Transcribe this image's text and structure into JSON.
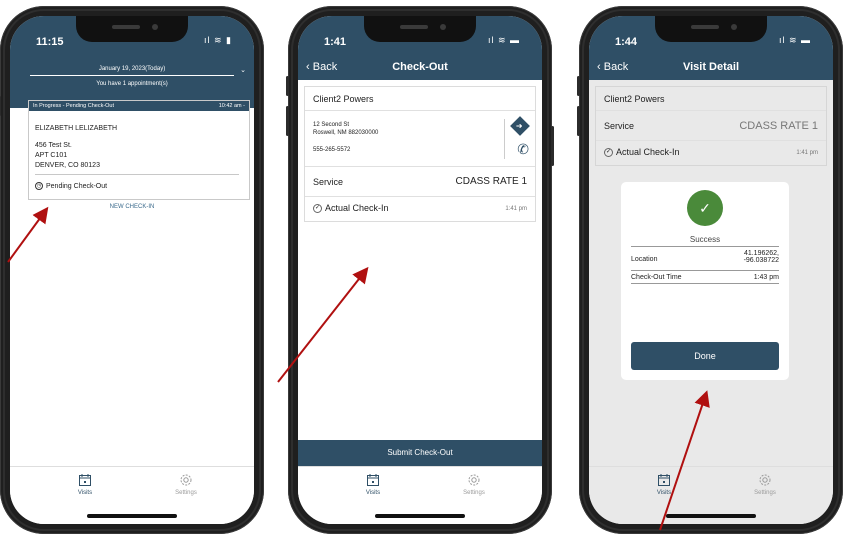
{
  "phone1": {
    "status_time": "11:15",
    "date_label": "January 19, 2023(Today)",
    "appointment_count": "You have 1 appointment(s)",
    "card": {
      "status": "In Progress - Pending Check-Out",
      "time": "10:42 am -",
      "client_name": "ELIZABETH LELIZABETH",
      "address_line1": "456 Test St.",
      "address_line2": "APT C101",
      "address_line3": "DENVER, CO 80123",
      "checkout_status": "Pending Check-Out"
    },
    "new_checkin": "NEW CHECK-IN",
    "tabs": {
      "visits": "Visits",
      "settings": "Settings"
    }
  },
  "phone2": {
    "status_time": "1:41",
    "nav": {
      "back": "Back",
      "title": "Check-Out"
    },
    "client_name": "Client2 Powers",
    "address_line1": "12 Second St",
    "address_line2": "Roswell, NM 882030000",
    "phone": "555-265-5572",
    "service_label": "Service",
    "service_value": "CDASS RATE 1",
    "checkin_label": "Actual Check-In",
    "checkin_time": "1:41 pm",
    "submit_label": "Submit Check-Out",
    "tabs": {
      "visits": "Visits",
      "settings": "Settings"
    }
  },
  "phone3": {
    "status_time": "1:44",
    "nav": {
      "back": "Back",
      "title": "Visit Detail"
    },
    "client_name": "Client2 Powers",
    "service_label": "Service",
    "service_value": "CDASS RATE 1",
    "checkin_label": "Actual Check-In",
    "checkin_time": "1:41 pm",
    "modal": {
      "title": "Success",
      "location_label": "Location",
      "location_value_line1": "41.196262,",
      "location_value_line2": "-96.038722",
      "checkout_label": "Check-Out Time",
      "checkout_value": "1:43 pm",
      "done_label": "Done"
    },
    "tabs": {
      "visits": "Visits",
      "settings": "Settings"
    }
  },
  "colors": {
    "brand": "#2f4f66",
    "success": "#4a8a3a",
    "arrow": "#b01010"
  }
}
